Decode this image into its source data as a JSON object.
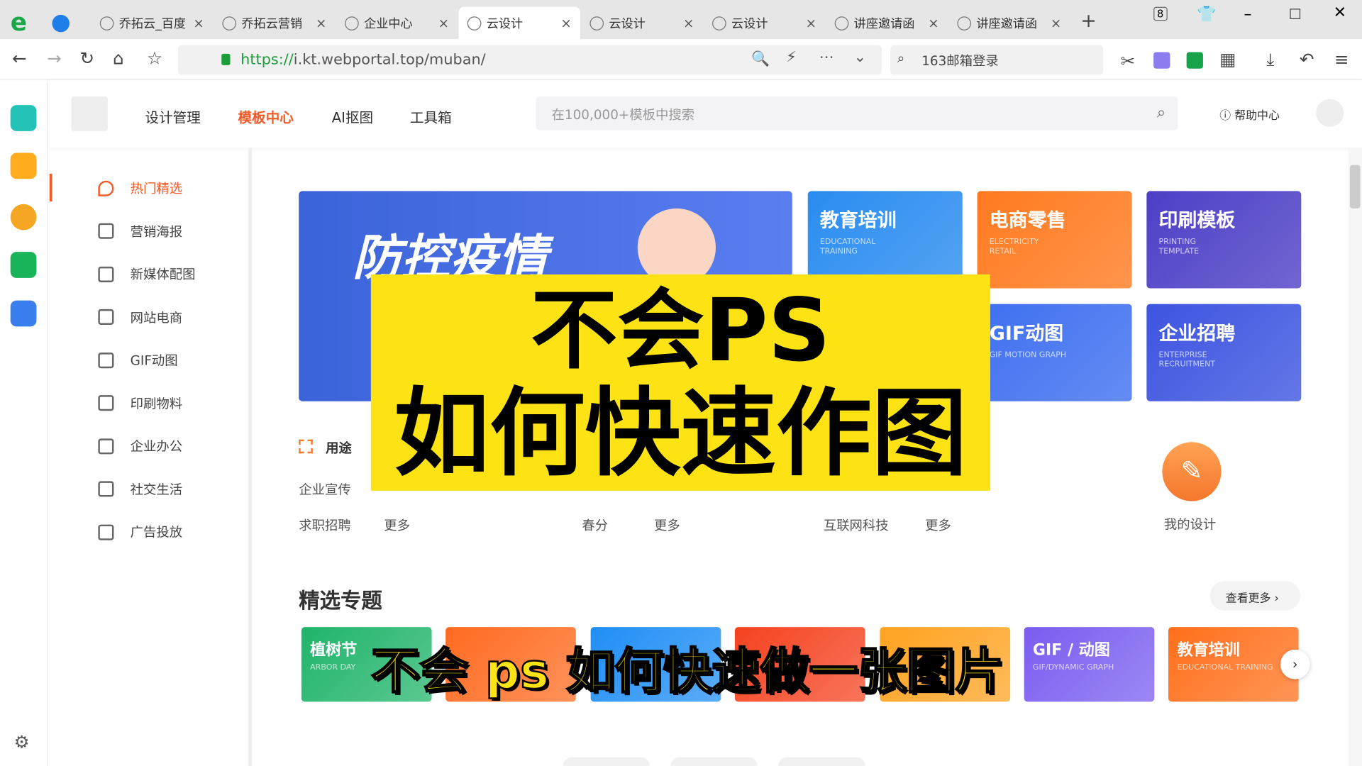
{
  "browser": {
    "tabs": [
      {
        "label": "乔拓云_百度"
      },
      {
        "label": "乔拓云营销"
      },
      {
        "label": "企业中心"
      },
      {
        "label": "云设计",
        "active": true
      },
      {
        "label": "云设计"
      },
      {
        "label": "云设计"
      },
      {
        "label": "讲座邀请函"
      },
      {
        "label": "讲座邀请函"
      }
    ],
    "tab_count": "8",
    "url_scheme": "https://",
    "url_rest": "i.kt.webportal.top/muban/",
    "search_box": "163邮箱登录"
  },
  "header": {
    "nav": [
      "设计管理",
      "模板中心",
      "AI抠图",
      "工具箱"
    ],
    "active_nav": "模板中心",
    "search_placeholder": "在100,000+模板中搜索",
    "help": "帮助中心"
  },
  "sidebar": {
    "items": [
      "热门精选",
      "营销海报",
      "新媒体配图",
      "网站电商",
      "GIF动图",
      "印刷物料",
      "企业办公",
      "社交生活",
      "广告投放"
    ]
  },
  "banner": {
    "title": "防控疫情"
  },
  "cards": [
    {
      "title": "教育培训",
      "en": "EDUCATIONAL TRAINING",
      "color": "#2a8cf0"
    },
    {
      "title": "电商零售",
      "en": "ELECTRICITY RETAIL",
      "color": "#ff7a1f"
    },
    {
      "title": "印刷模板",
      "en": "PRINTING TEMPLATE",
      "color": "#4d3fc6"
    },
    {
      "title": "GIF动图",
      "en": "GIF MOTION GRAPH",
      "color": "#3e6ff0"
    },
    {
      "title": "企业招聘",
      "en": "ENTERPRISE RECRUITMENT",
      "color": "#3d54e0"
    }
  ],
  "usage": {
    "label": "用途",
    "row1": [
      "企业宣传"
    ],
    "row2": [
      "求职招聘",
      "更多",
      "春分",
      "更多",
      "互联网科技",
      "更多"
    ]
  },
  "my_design": "我的设计",
  "featured": {
    "title": "精选专题",
    "more": "查看更多 ›",
    "topics": [
      {
        "title": "植树节",
        "en": "ARBOR DAY",
        "color": "#1fb46a"
      },
      {
        "title": "",
        "en": "",
        "color": "#ff6a1f"
      },
      {
        "title": "",
        "en": "",
        "color": "#1f8ef5"
      },
      {
        "title": "",
        "en": "",
        "color": "#f5421f"
      },
      {
        "title": "",
        "en": "",
        "color": "#ffa21f"
      },
      {
        "title": "GIF / 动图",
        "en": "GIF/DYNAMIC GRAPH",
        "color": "#7a5cf0"
      },
      {
        "title": "教育培训",
        "en": "EDUCATIONAL TRAINING",
        "color": "#ff6f1a"
      }
    ]
  },
  "overlay": {
    "line1": "不会PS",
    "line2": "如何快速作图",
    "subtitle": "不会 ps 如何快速做一张图片"
  },
  "colors": {
    "accent": "#f25b2a",
    "overlay": "#fde214"
  }
}
